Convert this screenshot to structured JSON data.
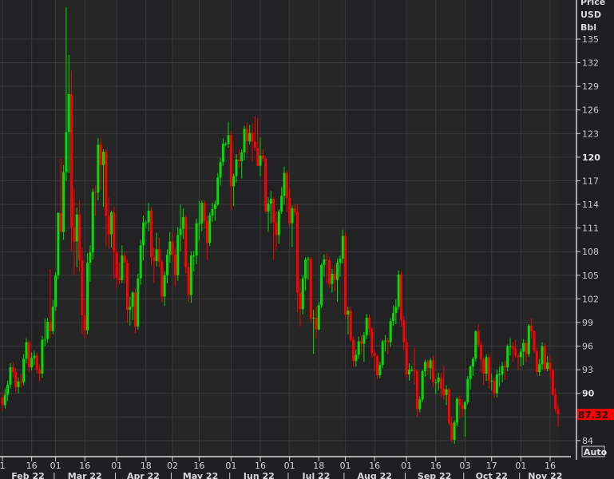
{
  "chart_data": {
    "type": "candlestick",
    "title": "",
    "ylabel_lines": [
      "Price",
      "USD",
      "Bbl"
    ],
    "ylim": [
      84,
      135
    ],
    "y_ticks": [
      84,
      87,
      90,
      93,
      96,
      99,
      102,
      105,
      108,
      111,
      114,
      117,
      120,
      123,
      126,
      129,
      132,
      135
    ],
    "y_ticks_bold": [
      90,
      120
    ],
    "grid": true,
    "last_price": "87.32",
    "last_price_color": "#ff0000",
    "up_color": "#00e000",
    "down_color": "#ff0000",
    "auto_button": "Auto",
    "x_ticks": [
      {
        "date": "2022-02-01",
        "label": "1"
      },
      {
        "date": "2022-02-16",
        "label": "16"
      },
      {
        "date": "2022-03-01",
        "label": "01"
      },
      {
        "date": "2022-03-16",
        "label": "16"
      },
      {
        "date": "2022-04-01",
        "label": "01"
      },
      {
        "date": "2022-04-18",
        "label": "18"
      },
      {
        "date": "2022-05-02",
        "label": "02"
      },
      {
        "date": "2022-05-16",
        "label": "16"
      },
      {
        "date": "2022-06-01",
        "label": "01"
      },
      {
        "date": "2022-06-16",
        "label": "16"
      },
      {
        "date": "2022-07-01",
        "label": "01"
      },
      {
        "date": "2022-07-18",
        "label": "18"
      },
      {
        "date": "2022-08-01",
        "label": "01"
      },
      {
        "date": "2022-08-16",
        "label": "16"
      },
      {
        "date": "2022-09-01",
        "label": "01"
      },
      {
        "date": "2022-09-16",
        "label": "16"
      },
      {
        "date": "2022-10-03",
        "label": "03"
      },
      {
        "date": "2022-10-17",
        "label": "17"
      },
      {
        "date": "2022-11-01",
        "label": "01"
      },
      {
        "date": "2022-11-16",
        "label": "16"
      }
    ],
    "months": [
      {
        "month": "2022-02",
        "label": "Feb 22"
      },
      {
        "month": "2022-03",
        "label": "Mar 22"
      },
      {
        "month": "2022-04",
        "label": "Apr 22"
      },
      {
        "month": "2022-05",
        "label": "May 22"
      },
      {
        "month": "2022-06",
        "label": "Jun 22"
      },
      {
        "month": "2022-07",
        "label": "Jul 22"
      },
      {
        "month": "2022-08",
        "label": "Aug 22"
      },
      {
        "month": "2022-09",
        "label": "Sep 22"
      },
      {
        "month": "2022-10",
        "label": "Oct 22"
      },
      {
        "month": "2022-11",
        "label": "Nov 22"
      }
    ],
    "ohlc_fields": [
      "open",
      "high",
      "low",
      "close"
    ],
    "ohlc": [
      [
        89.5,
        90.2,
        87.8,
        88.5
      ],
      [
        88.5,
        90.6,
        88.1,
        89.8
      ],
      [
        89.8,
        91.6,
        89.0,
        91.1
      ],
      [
        91.1,
        93.8,
        90.6,
        93.3
      ],
      [
        93.3,
        94.0,
        92.0,
        92.7
      ],
      [
        92.7,
        93.2,
        90.2,
        90.8
      ],
      [
        90.8,
        92.0,
        90.0,
        91.5
      ],
      [
        91.5,
        92.5,
        90.7,
        91.4
      ],
      [
        91.4,
        95.0,
        91.0,
        94.4
      ],
      [
        94.4,
        97.0,
        93.8,
        96.5
      ],
      [
        96.5,
        96.8,
        92.6,
        93.3
      ],
      [
        93.3,
        95.2,
        92.9,
        94.5
      ],
      [
        94.5,
        95.4,
        93.6,
        94.8
      ],
      [
        94.8,
        95.2,
        92.5,
        93.0
      ],
      [
        93.0,
        93.6,
        91.5,
        92.5
      ],
      [
        92.5,
        97.3,
        92.0,
        96.8
      ],
      [
        96.8,
        99.5,
        96.0,
        96.9
      ],
      [
        96.9,
        99.6,
        96.4,
        99.1
      ],
      [
        99.1,
        105.8,
        97.0,
        97.9
      ],
      [
        97.9,
        101.9,
        97.5,
        101.0
      ],
      [
        101.0,
        105.4,
        100.5,
        105.0
      ],
      [
        105.0,
        113.0,
        104.5,
        112.9
      ],
      [
        112.9,
        119.8,
        110.8,
        110.5
      ],
      [
        110.5,
        119.0,
        109.5,
        118.1
      ],
      [
        118.1,
        139.1,
        117.0,
        123.2
      ],
      [
        123.2,
        133.0,
        118.0,
        128.0
      ],
      [
        128.0,
        131.0,
        108.0,
        111.1
      ],
      [
        111.1,
        116.0,
        105.0,
        109.3
      ],
      [
        109.3,
        113.6,
        106.0,
        112.7
      ],
      [
        112.7,
        114.5,
        105.5,
        106.9
      ],
      [
        106.9,
        108.5,
        97.5,
        99.9
      ],
      [
        99.9,
        102.0,
        97.0,
        98.0
      ],
      [
        98.0,
        107.8,
        97.5,
        106.6
      ],
      [
        106.6,
        108.8,
        104.2,
        107.9
      ],
      [
        107.9,
        116.0,
        107.0,
        115.6
      ],
      [
        115.6,
        116.4,
        112.5,
        115.5
      ],
      [
        115.5,
        122.4,
        114.5,
        121.6
      ],
      [
        121.6,
        122.4,
        115.8,
        119.0
      ],
      [
        119.0,
        121.0,
        113.7,
        120.7
      ],
      [
        120.7,
        121.0,
        108.7,
        112.5
      ],
      [
        112.5,
        114.9,
        108.4,
        110.2
      ],
      [
        110.2,
        113.2,
        108.5,
        113.0
      ],
      [
        113.0,
        113.7,
        104.5,
        107.9
      ],
      [
        107.9,
        108.4,
        103.4,
        104.7
      ],
      [
        104.7,
        106.6,
        103.9,
        104.4
      ],
      [
        104.4,
        108.8,
        104.0,
        107.5
      ],
      [
        107.5,
        108.0,
        104.0,
        106.6
      ],
      [
        106.6,
        107.0,
        99.0,
        100.6
      ],
      [
        100.6,
        102.3,
        98.6,
        101.0
      ],
      [
        101.0,
        103.0,
        99.3,
        102.8
      ],
      [
        102.8,
        103.3,
        97.6,
        98.5
      ],
      [
        98.5,
        105.2,
        98.1,
        104.6
      ],
      [
        104.6,
        109.5,
        103.8,
        108.8
      ],
      [
        108.8,
        112.6,
        106.9,
        111.7
      ],
      [
        111.7,
        112.0,
        111.0,
        111.7
      ],
      [
        111.7,
        114.2,
        110.6,
        113.2
      ],
      [
        113.2,
        113.7,
        106.3,
        107.3
      ],
      [
        107.3,
        108.5,
        104.0,
        106.8
      ],
      [
        106.8,
        110.4,
        106.1,
        108.3
      ],
      [
        108.3,
        109.8,
        106.0,
        106.7
      ],
      [
        106.7,
        107.0,
        101.6,
        102.3
      ],
      [
        102.3,
        105.5,
        101.1,
        105.0
      ],
      [
        105.0,
        108.3,
        104.0,
        107.6
      ],
      [
        107.6,
        110.5,
        106.6,
        109.3
      ],
      [
        109.3,
        110.5,
        106.7,
        107.6
      ],
      [
        107.6,
        108.4,
        103.6,
        105.0
      ],
      [
        105.0,
        111.1,
        104.3,
        110.1
      ],
      [
        110.1,
        114.0,
        108.0,
        110.9
      ],
      [
        110.9,
        113.5,
        109.6,
        112.4
      ],
      [
        112.4,
        112.6,
        105.2,
        106.0
      ],
      [
        106.0,
        106.6,
        101.6,
        102.5
      ],
      [
        102.5,
        108.0,
        101.5,
        107.5
      ],
      [
        107.5,
        108.1,
        105.5,
        107.5
      ],
      [
        107.5,
        112.2,
        106.4,
        111.6
      ],
      [
        111.6,
        114.4,
        109.4,
        111.6
      ],
      [
        111.6,
        114.5,
        110.6,
        114.2
      ],
      [
        114.2,
        114.5,
        110.9,
        111.9
      ],
      [
        111.9,
        112.6,
        107.0,
        109.1
      ],
      [
        109.1,
        113.0,
        108.7,
        112.6
      ],
      [
        112.6,
        114.2,
        111.8,
        113.4
      ],
      [
        113.4,
        114.5,
        111.9,
        114.0
      ],
      [
        114.0,
        118.0,
        113.8,
        117.4
      ],
      [
        117.4,
        119.9,
        116.4,
        119.4
      ],
      [
        119.4,
        122.4,
        118.9,
        121.7
      ],
      [
        121.7,
        121.9,
        121.4,
        121.7
      ],
      [
        121.7,
        124.5,
        121.2,
        122.8
      ],
      [
        122.8,
        123.3,
        113.3,
        116.3
      ],
      [
        116.3,
        117.9,
        113.8,
        117.6
      ],
      [
        117.6,
        120.4,
        116.8,
        119.7
      ],
      [
        119.7,
        121.0,
        118.6,
        119.5
      ],
      [
        119.5,
        121.0,
        117.3,
        120.6
      ],
      [
        120.6,
        124.0,
        119.6,
        123.6
      ],
      [
        123.6,
        124.4,
        120.4,
        122.0
      ],
      [
        122.0,
        124.1,
        121.6,
        123.1
      ],
      [
        123.1,
        124.3,
        119.4,
        122.0
      ],
      [
        122.0,
        125.2,
        120.8,
        121.2
      ],
      [
        121.2,
        125.0,
        118.9,
        118.9
      ],
      [
        118.9,
        122.5,
        117.6,
        120.2
      ],
      [
        120.2,
        121.0,
        119.4,
        119.8
      ],
      [
        119.8,
        120.0,
        112.9,
        113.1
      ],
      [
        113.1,
        114.9,
        110.5,
        114.1
      ],
      [
        114.1,
        115.7,
        111.6,
        114.7
      ],
      [
        114.7,
        115.0,
        107.0,
        111.7
      ],
      [
        111.7,
        113.0,
        108.2,
        110.1
      ],
      [
        110.1,
        113.4,
        109.0,
        113.1
      ],
      [
        113.1,
        116.2,
        112.8,
        115.1
      ],
      [
        115.1,
        118.8,
        114.0,
        118.0
      ],
      [
        118.0,
        118.3,
        113.0,
        114.8
      ],
      [
        114.8,
        116.0,
        111.2,
        111.6
      ],
      [
        111.6,
        113.9,
        108.6,
        113.5
      ],
      [
        113.5,
        114.0,
        112.5,
        113.0
      ],
      [
        113.0,
        114.0,
        100.3,
        102.8
      ],
      [
        102.8,
        104.5,
        98.5,
        100.7
      ],
      [
        100.7,
        105.0,
        100.0,
        104.6
      ],
      [
        104.6,
        107.3,
        103.1,
        107.0
      ],
      [
        107.0,
        107.4,
        104.4,
        107.1
      ],
      [
        107.1,
        107.3,
        99.0,
        99.5
      ],
      [
        99.5,
        100.6,
        95.0,
        99.6
      ],
      [
        99.6,
        101.0,
        97.0,
        98.1
      ],
      [
        98.1,
        101.6,
        98.0,
        101.2
      ],
      [
        101.2,
        106.5,
        100.9,
        106.3
      ],
      [
        106.3,
        107.6,
        104.8,
        107.0
      ],
      [
        107.0,
        107.8,
        104.0,
        106.9
      ],
      [
        106.9,
        107.3,
        103.4,
        103.9
      ],
      [
        103.9,
        105.8,
        102.8,
        105.2
      ],
      [
        105.2,
        106.3,
        103.0,
        104.4
      ],
      [
        104.4,
        107.1,
        101.6,
        106.6
      ],
      [
        106.6,
        107.5,
        104.8,
        107.1
      ],
      [
        107.1,
        110.8,
        106.5,
        110.0
      ],
      [
        110.0,
        110.5,
        99.5,
        100.0
      ],
      [
        100.0,
        101.0,
        97.5,
        100.5
      ],
      [
        100.5,
        101.0,
        96.5,
        96.8
      ],
      [
        96.8,
        97.2,
        93.4,
        94.1
      ],
      [
        94.1,
        95.6,
        93.4,
        94.9
      ],
      [
        94.9,
        97.2,
        94.4,
        96.6
      ],
      [
        96.6,
        97.3,
        95.0,
        96.3
      ],
      [
        96.3,
        97.8,
        94.0,
        97.4
      ],
      [
        97.4,
        100.1,
        96.9,
        99.6
      ],
      [
        99.6,
        100.0,
        97.3,
        98.2
      ],
      [
        98.2,
        98.4,
        94.5,
        95.1
      ],
      [
        95.1,
        95.5,
        92.8,
        94.7
      ],
      [
        94.7,
        94.9,
        91.8,
        92.3
      ],
      [
        92.3,
        94.0,
        91.9,
        93.6
      ],
      [
        93.6,
        96.8,
        93.2,
        96.6
      ],
      [
        96.6,
        97.4,
        95.3,
        96.7
      ],
      [
        96.7,
        97.1,
        95.0,
        96.5
      ],
      [
        96.5,
        99.6,
        95.9,
        99.2
      ],
      [
        99.2,
        101.2,
        98.6,
        100.2
      ],
      [
        100.2,
        101.9,
        98.8,
        101.0
      ],
      [
        101.0,
        105.6,
        100.6,
        105.1
      ],
      [
        105.1,
        105.5,
        98.5,
        99.3
      ],
      [
        99.3,
        99.8,
        95.5,
        96.5
      ],
      [
        96.5,
        97.0,
        92.0,
        92.4
      ],
      [
        92.4,
        93.8,
        91.6,
        93.0
      ],
      [
        93.0,
        93.5,
        92.8,
        93.0
      ],
      [
        93.0,
        95.8,
        91.2,
        92.8
      ],
      [
        92.8,
        93.0,
        87.0,
        88.0
      ],
      [
        88.0,
        89.6,
        87.6,
        89.2
      ],
      [
        89.2,
        93.0,
        88.9,
        92.8
      ],
      [
        92.8,
        94.3,
        92.1,
        94.0
      ],
      [
        94.0,
        94.3,
        92.3,
        93.2
      ],
      [
        93.2,
        94.5,
        91.8,
        94.2
      ],
      [
        94.2,
        94.8,
        90.8,
        91.4
      ],
      [
        91.4,
        91.8,
        89.9,
        91.4
      ],
      [
        91.4,
        92.6,
        90.4,
        92.0
      ],
      [
        92.0,
        92.6,
        89.6,
        90.6
      ],
      [
        90.6,
        93.5,
        89.2,
        89.8
      ],
      [
        89.8,
        91.0,
        88.5,
        90.5
      ],
      [
        90.5,
        90.7,
        85.9,
        86.2
      ],
      [
        86.2,
        87.0,
        83.8,
        84.1
      ],
      [
        84.1,
        86.6,
        83.6,
        86.3
      ],
      [
        86.3,
        89.5,
        85.8,
        89.3
      ],
      [
        89.3,
        89.7,
        86.8,
        88.5
      ],
      [
        88.5,
        89.2,
        87.0,
        88.0
      ],
      [
        88.0,
        89.0,
        84.5,
        88.9
      ],
      [
        88.9,
        92.2,
        88.6,
        91.8
      ],
      [
        91.8,
        93.6,
        90.5,
        93.4
      ],
      [
        93.4,
        94.6,
        92.2,
        94.4
      ],
      [
        94.4,
        98.0,
        94.0,
        97.9
      ],
      [
        97.9,
        98.8,
        95.8,
        96.2
      ],
      [
        96.2,
        96.6,
        92.6,
        94.3
      ],
      [
        94.3,
        94.5,
        91.0,
        92.5
      ],
      [
        92.5,
        95.0,
        91.6,
        94.6
      ],
      [
        94.6,
        95.0,
        90.6,
        91.6
      ],
      [
        91.6,
        92.5,
        90.4,
        91.6
      ],
      [
        91.6,
        92.0,
        89.4,
        90.0
      ],
      [
        90.0,
        93.0,
        89.5,
        92.4
      ],
      [
        92.4,
        93.4,
        90.8,
        92.4
      ],
      [
        92.4,
        94.0,
        91.4,
        93.5
      ],
      [
        93.5,
        94.1,
        91.7,
        93.3
      ],
      [
        93.3,
        96.2,
        92.8,
        96.0
      ],
      [
        96.0,
        97.0,
        94.8,
        96.0
      ],
      [
        96.0,
        96.5,
        94.0,
        95.7
      ],
      [
        95.7,
        96.8,
        94.5,
        94.8
      ],
      [
        94.8,
        95.0,
        93.0,
        94.6
      ],
      [
        94.6,
        95.7,
        93.4,
        95.3
      ],
      [
        95.3,
        96.9,
        93.6,
        96.4
      ],
      [
        96.4,
        96.7,
        94.0,
        95.0
      ],
      [
        95.0,
        98.8,
        94.6,
        98.6
      ],
      [
        98.6,
        99.5,
        97.0,
        97.9
      ],
      [
        97.9,
        98.0,
        95.1,
        95.4
      ],
      [
        95.4,
        95.8,
        92.3,
        92.7
      ],
      [
        92.7,
        94.4,
        92.2,
        93.7
      ],
      [
        93.7,
        96.5,
        93.0,
        96.0
      ],
      [
        96.0,
        96.3,
        92.9,
        93.1
      ],
      [
        93.1,
        94.7,
        92.8,
        93.9
      ],
      [
        93.9,
        94.8,
        92.0,
        92.9
      ],
      [
        92.9,
        93.2,
        89.7,
        89.8
      ],
      [
        89.8,
        90.6,
        87.6,
        88.0
      ],
      [
        88.0,
        88.5,
        85.7,
        87.32
      ]
    ]
  }
}
